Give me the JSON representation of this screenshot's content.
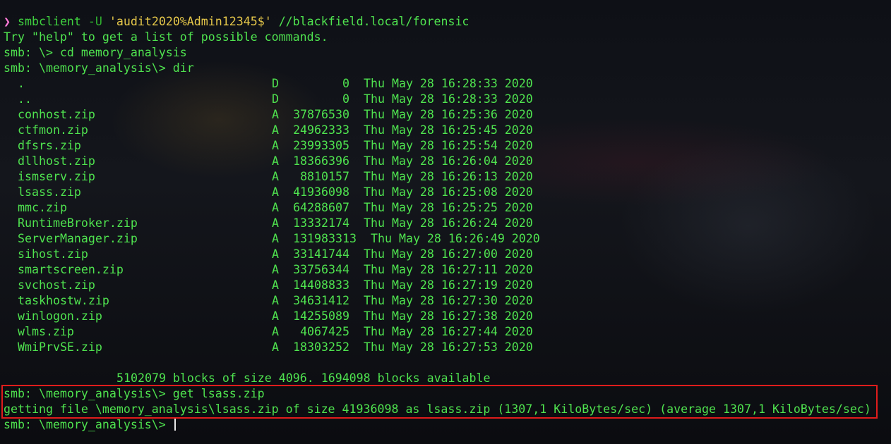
{
  "terminal": {
    "command_line": {
      "arrow": "❯",
      "program": "smbclient",
      "flag": "-U",
      "credential": "'audit2020%Admin12345$'",
      "target": "//blackfield.local/forensic"
    },
    "help_line": "Try \"help\" to get a list of possible commands.",
    "cd_line": "smb: \\> cd memory_analysis",
    "dir_line": "smb: \\memory_analysis\\> dir",
    "files": [
      {
        "name": ".",
        "attr": "D",
        "size": "0",
        "date": "Thu May 28 16:28:33 2020"
      },
      {
        "name": "..",
        "attr": "D",
        "size": "0",
        "date": "Thu May 28 16:28:33 2020"
      },
      {
        "name": "conhost.zip",
        "attr": "A",
        "size": "37876530",
        "date": "Thu May 28 16:25:36 2020"
      },
      {
        "name": "ctfmon.zip",
        "attr": "A",
        "size": "24962333",
        "date": "Thu May 28 16:25:45 2020"
      },
      {
        "name": "dfsrs.zip",
        "attr": "A",
        "size": "23993305",
        "date": "Thu May 28 16:25:54 2020"
      },
      {
        "name": "dllhost.zip",
        "attr": "A",
        "size": "18366396",
        "date": "Thu May 28 16:26:04 2020"
      },
      {
        "name": "ismserv.zip",
        "attr": "A",
        "size": "8810157",
        "date": "Thu May 28 16:26:13 2020"
      },
      {
        "name": "lsass.zip",
        "attr": "A",
        "size": "41936098",
        "date": "Thu May 28 16:25:08 2020"
      },
      {
        "name": "mmc.zip",
        "attr": "A",
        "size": "64288607",
        "date": "Thu May 28 16:25:25 2020"
      },
      {
        "name": "RuntimeBroker.zip",
        "attr": "A",
        "size": "13332174",
        "date": "Thu May 28 16:26:24 2020"
      },
      {
        "name": "ServerManager.zip",
        "attr": "A",
        "size": "131983313",
        "date": "Thu May 28 16:26:49 2020"
      },
      {
        "name": "sihost.zip",
        "attr": "A",
        "size": "33141744",
        "date": "Thu May 28 16:27:00 2020"
      },
      {
        "name": "smartscreen.zip",
        "attr": "A",
        "size": "33756344",
        "date": "Thu May 28 16:27:11 2020"
      },
      {
        "name": "svchost.zip",
        "attr": "A",
        "size": "14408833",
        "date": "Thu May 28 16:27:19 2020"
      },
      {
        "name": "taskhostw.zip",
        "attr": "A",
        "size": "34631412",
        "date": "Thu May 28 16:27:30 2020"
      },
      {
        "name": "winlogon.zip",
        "attr": "A",
        "size": "14255089",
        "date": "Thu May 28 16:27:38 2020"
      },
      {
        "name": "wlms.zip",
        "attr": "A",
        "size": "4067425",
        "date": "Thu May 28 16:27:44 2020"
      },
      {
        "name": "WmiPrvSE.zip",
        "attr": "A",
        "size": "18303252",
        "date": "Thu May 28 16:27:53 2020"
      }
    ],
    "blocks_line": "5102079 blocks of size 4096. 1694098 blocks available",
    "get_line": "smb: \\memory_analysis\\> get lsass.zip",
    "getting_line": "getting file \\memory_analysis\\lsass.zip of size 41936098 as lsass.zip (1307,1 KiloBytes/sec) (average 1307,1 KiloBytes/sec)",
    "final_prompt": "smb: \\memory_analysis\\> "
  }
}
